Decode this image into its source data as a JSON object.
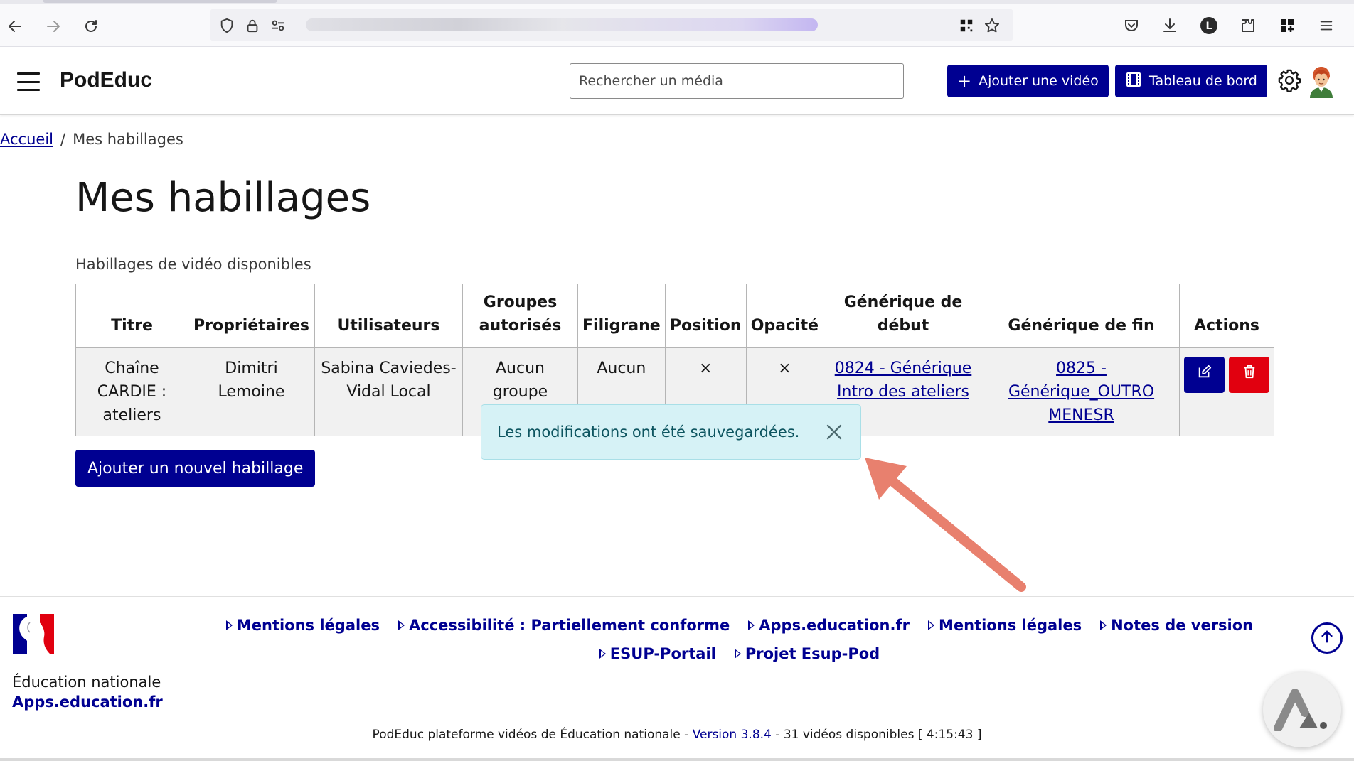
{
  "app": {
    "name": "PodEduc",
    "search_placeholder": "Rechercher un média",
    "add_video_label": "Ajouter une vidéo",
    "dashboard_label": "Tableau de bord"
  },
  "breadcrumb": {
    "home": "Accueil",
    "separator": "/",
    "current": "Mes habillages"
  },
  "page": {
    "title": "Mes habillages",
    "caption": "Habillages de vidéo disponibles",
    "add_button": "Ajouter un nouvel habillage"
  },
  "table": {
    "headers": {
      "title": "Titre",
      "owners": "Propriétaires",
      "users": "Utilisateurs",
      "groups": "Groupes autorisés",
      "watermark": "Filigrane",
      "position": "Position",
      "opacity": "Opacité",
      "intro": "Générique de début",
      "outro": "Générique de fin",
      "actions": "Actions"
    },
    "rows": [
      {
        "title": "Chaîne CARDIE : ateliers",
        "owners": "Dimitri Lemoine",
        "users": "Sabina Caviedes-Vidal Local",
        "groups": "Aucun groupe",
        "watermark": "Aucun",
        "position": "×",
        "opacity": "×",
        "intro": "0824 - Générique Intro des ateliers",
        "outro": "0825 - Générique_OUTRO MENESR"
      }
    ]
  },
  "toast": {
    "message": "Les modifications ont été sauvegardées."
  },
  "footer": {
    "brand_line1": "Éducation nationale",
    "brand_line2": "Apps.education.fr",
    "links": [
      "Mentions légales",
      "Accessibilité : Partiellement conforme",
      "Apps.education.fr",
      "Mentions légales",
      "Notes de version",
      "ESUP-Portail",
      "Projet Esup-Pod"
    ],
    "meta_prefix": "PodEduc plateforme vidéos de Éducation nationale - ",
    "meta_version": "Version 3.8.4",
    "meta_suffix": " - 31 vidéos disponibles [ 4:15:43 ]"
  },
  "colors": {
    "primary": "#000091",
    "danger": "#e1000f",
    "toast_bg": "#d6f2f6",
    "arrow": "#e8806e"
  }
}
